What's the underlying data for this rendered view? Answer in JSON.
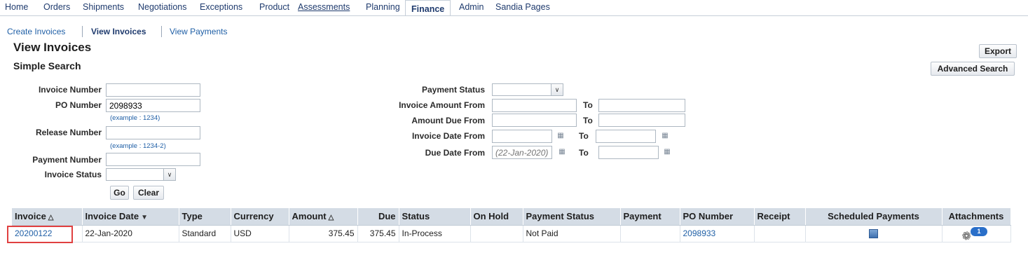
{
  "nav": {
    "tabs": [
      "Home",
      "Orders",
      "Shipments",
      "Negotiations",
      "Exceptions",
      "Product",
      "Assessments",
      "Planning",
      "Finance",
      "Admin",
      "Sandia Pages"
    ],
    "active": "Finance"
  },
  "subnav": {
    "items": [
      "Create Invoices",
      "View Invoices",
      "View Payments"
    ]
  },
  "page": {
    "title": "View Invoices",
    "section": "Simple Search",
    "export_label": "Export",
    "advanced_label": "Advanced Search"
  },
  "form": {
    "invoice_number": {
      "label": "Invoice Number",
      "value": ""
    },
    "po_number": {
      "label": "PO Number",
      "value": "2098933",
      "hint": "(example : 1234)"
    },
    "release_number": {
      "label": "Release Number",
      "value": "",
      "hint": "(example : 1234-2)"
    },
    "payment_number": {
      "label": "Payment Number",
      "value": ""
    },
    "invoice_status": {
      "label": "Invoice Status",
      "value": ""
    },
    "payment_status": {
      "label": "Payment Status",
      "value": ""
    },
    "invoice_amount_from": {
      "label": "Invoice Amount From",
      "value": ""
    },
    "invoice_amount_to": {
      "value": ""
    },
    "amount_due_from": {
      "label": "Amount Due From",
      "value": ""
    },
    "amount_due_to": {
      "value": ""
    },
    "invoice_date_from": {
      "label": "Invoice Date From",
      "value": ""
    },
    "invoice_date_to": {
      "value": ""
    },
    "due_date_from": {
      "label": "Due Date From",
      "placeholder": "(22-Jan-2020)"
    },
    "due_date_to": {
      "value": ""
    },
    "to_label": "To",
    "go_label": "Go",
    "clear_label": "Clear"
  },
  "table": {
    "columns": [
      "Invoice",
      "Invoice Date",
      "Type",
      "Currency",
      "Amount",
      "Due",
      "Status",
      "On Hold",
      "Payment Status",
      "Payment",
      "PO Number",
      "Receipt",
      "Scheduled Payments",
      "Attachments"
    ],
    "rows": [
      {
        "invoice": "20200122",
        "invoice_date": "22-Jan-2020",
        "type": "Standard",
        "currency": "USD",
        "amount": "375.45",
        "due": "375.45",
        "status": "In-Process",
        "on_hold": "",
        "payment_status": "Not Paid",
        "payment": "",
        "po_number": "2098933",
        "receipt": "",
        "attachments_count": "1"
      }
    ]
  },
  "colors": {
    "link": "#1f5fa6",
    "header_bg": "#d4dce5",
    "highlight": "#e04040"
  }
}
